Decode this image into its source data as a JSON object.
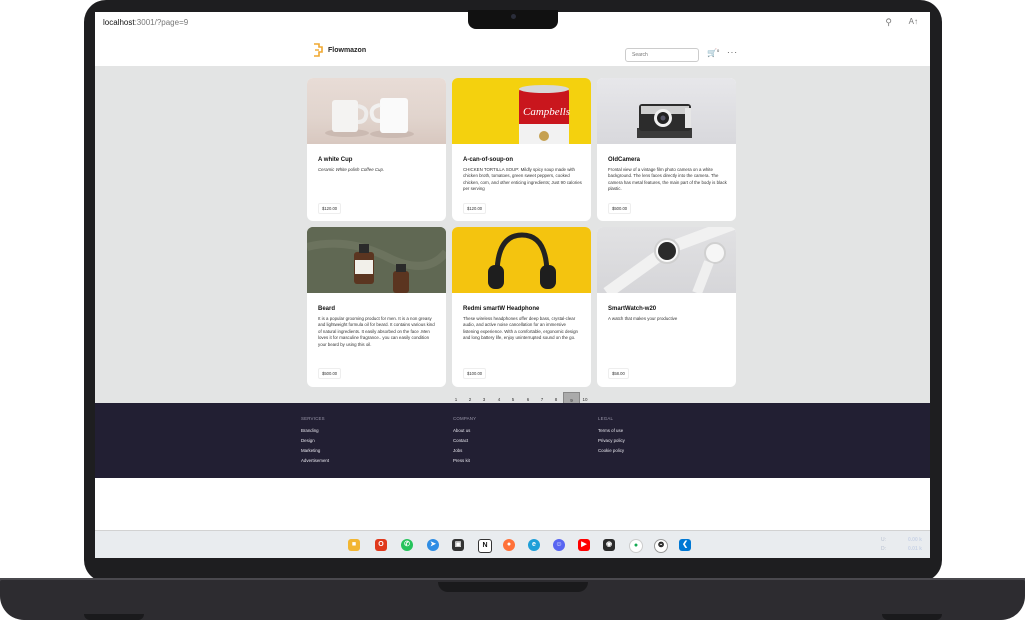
{
  "browser": {
    "url_host": "localhost",
    "url_path": ":3001/?page=9"
  },
  "app": {
    "brand": "Flowmazon",
    "search_placeholder": "Search",
    "cart_count": "0",
    "more_label": "···"
  },
  "products": [
    {
      "title": "A white Cup",
      "desc": "Ceramic White polish Coffee Cup.",
      "price": "$120.00"
    },
    {
      "title": "A-can-of-soup-on",
      "desc": "CHICKEN TORTILLA SOUP: Mildly spicy soup made with chicken broth, tomatoes, green sweet peppers, cooked chicken, corn, and other enticing ingredients; Just 90 calories per serving",
      "price": "$120.00"
    },
    {
      "title": "OldCamera",
      "desc": "Frontal view of a vintage film photo camera on a white background. The lens faces directly into the camera. The camera has metal features, the main part of the body is black plastic.",
      "price": "$500.00"
    },
    {
      "title": "Beard",
      "desc": "It is a popular grooming product for men. It is a non greasy and lightweight formula oil for beard. It contains various kind of natural ingredients. It easily absorbed on the face .Men loves it for masculine fragrance.. you can easily condition your beard by using this oil.",
      "price": "$500.00"
    },
    {
      "title": "Redmi smartW Headphone",
      "desc": "These wireless headphones offer deep bass, crystal-clear audio, and active noise cancellation for an immersive listening experience. With a comfortable, ergonomic design and long battery life, enjoy uninterrupted sound on the go.",
      "price": "$100.00"
    },
    {
      "title": "SmartWatch-w20",
      "desc": "A watch that makes your productive",
      "price": "$58.00"
    }
  ],
  "pagination": {
    "pages": [
      "1",
      "2",
      "3",
      "4",
      "5",
      "6",
      "7",
      "8",
      "9",
      "10"
    ],
    "current": "9"
  },
  "footer": {
    "services": {
      "heading": "SERVICES",
      "links": [
        "Branding",
        "Design",
        "Marketing",
        "Advertisement"
      ]
    },
    "company": {
      "heading": "COMPANY",
      "links": [
        "About us",
        "Contact",
        "Jobs",
        "Press kit"
      ]
    },
    "legal": {
      "heading": "LEGAL",
      "links": [
        "Terms of use",
        "Privacy policy",
        "Cookie policy"
      ]
    }
  },
  "taskbar": {
    "apps": [
      "file-explorer",
      "office",
      "whatsapp",
      "telegram",
      "screen-share",
      "notion",
      "firefox",
      "edge",
      "discord",
      "youtube",
      "alarm-app",
      "mongodb",
      "chatgpt",
      "vscode"
    ],
    "tray_up_label": "U:",
    "tray_down_label": "D:",
    "tray_up_value": "0.00 k",
    "tray_down_value": "0.01 k"
  },
  "colors": {
    "page_bg": "#e3e4e4",
    "footer_bg": "#221f33",
    "logo_accent": "#f0a830",
    "active_page": "#aaaaaa"
  }
}
